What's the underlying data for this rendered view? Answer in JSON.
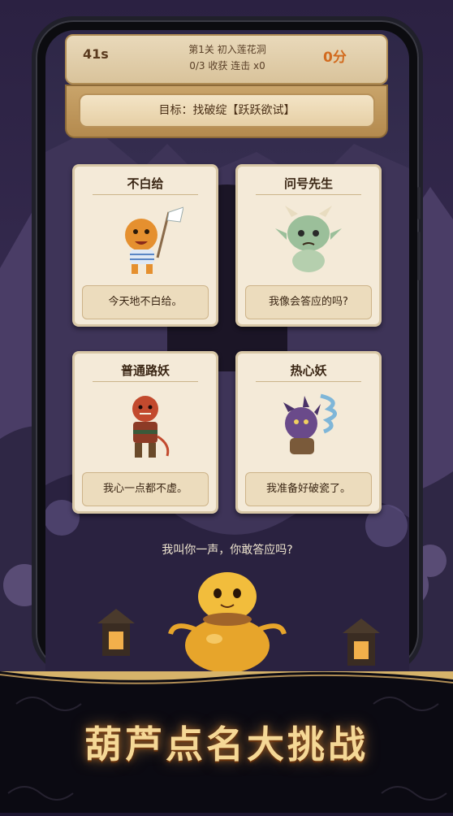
{
  "hud": {
    "timer": "41s",
    "score": "0分",
    "stage": "第1关 初入莲花洞",
    "stats": "0/3 收获   连击 x0",
    "goal": "目标：找破绽【跃跃欲试】"
  },
  "cards": [
    {
      "title": "不白给",
      "quote": "今天地不白给。"
    },
    {
      "title": "问号先生",
      "quote": "我像会答应的吗?"
    },
    {
      "title": "普通路妖",
      "quote": "我心一点都不虚。"
    },
    {
      "title": "热心妖",
      "quote": "我准备好破瓷了。"
    }
  ],
  "prompt": "我叫你一声，你敢答应吗?",
  "banner": "葫芦点名大挑战",
  "colors": {
    "accent": "#d26b1f",
    "parchment": "#f4ead8",
    "gold": "#f5d896"
  }
}
